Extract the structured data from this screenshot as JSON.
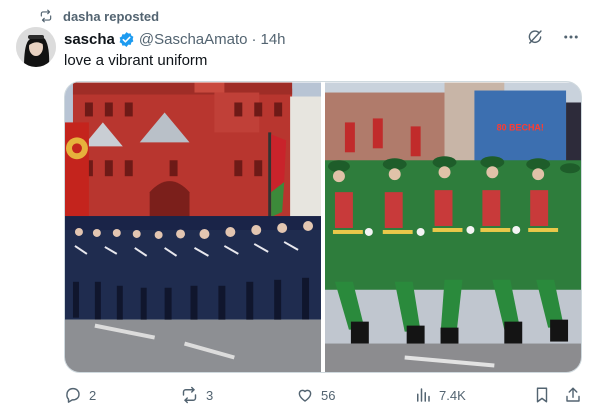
{
  "repost": {
    "label": "dasha reposted",
    "icon": "repost-icon"
  },
  "author": {
    "name": "sascha",
    "handle": "@SaschaAmato",
    "separator": "·",
    "time": "14h",
    "verified": true,
    "badge_color": "#1d9bf0"
  },
  "post": {
    "text": "love a vibrant uniform"
  },
  "media": {
    "images": [
      {
        "alt": "parade-blue-uniforms"
      },
      {
        "alt": "parade-green-uniforms",
        "banner_text": "80 ВЕСНА!"
      }
    ]
  },
  "actions": {
    "replies": "2",
    "reposts": "3",
    "likes": "56",
    "views": "7.4K"
  },
  "colors": {
    "secondary_text": "#536471",
    "primary_text": "#0f1419",
    "border": "#cfd9de"
  }
}
